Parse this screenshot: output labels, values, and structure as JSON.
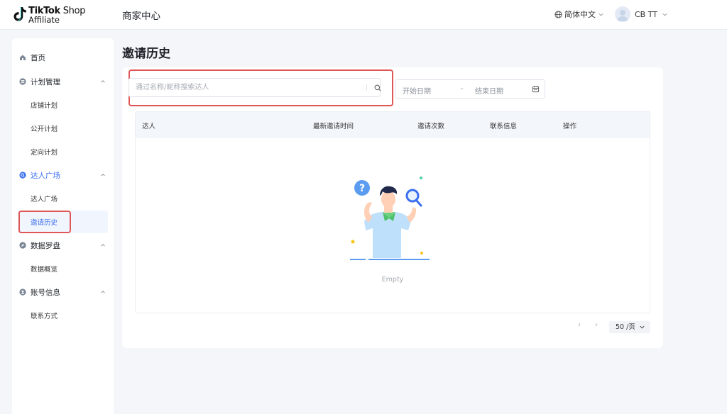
{
  "header": {
    "logo": {
      "line1_bold": "TikTok",
      "line1_light": " Shop",
      "line2": "Affiliate"
    },
    "title": "商家中心",
    "language": "简体中文",
    "user_name": "CB TT"
  },
  "sidebar": {
    "home": "首页",
    "groups": [
      {
        "label": "计划管理",
        "icon": "list-icon",
        "items": [
          "店铺计划",
          "公开计划",
          "定向计划"
        ]
      },
      {
        "label": "达人广场",
        "icon": "search-circle-icon",
        "items": [
          "达人广场",
          "邀请历史"
        ]
      },
      {
        "label": "数据罗盘",
        "icon": "compass-icon",
        "items": [
          "数据概览"
        ]
      },
      {
        "label": "账号信息",
        "icon": "account-icon",
        "items": [
          "联系方式"
        ]
      }
    ],
    "active_item": "邀请历史"
  },
  "main": {
    "page_title": "邀请历史",
    "search": {
      "placeholder": "通过名称/昵称搜索达人",
      "value": ""
    },
    "date_range": {
      "start_placeholder": "开始日期",
      "separator": "-",
      "end_placeholder": "结束日期"
    },
    "table": {
      "columns": [
        "达人",
        "最新邀请时间",
        "邀请次数",
        "联系信息",
        "操作"
      ],
      "rows": [],
      "empty_text": "Empty"
    },
    "pagination": {
      "prev": "‹",
      "next": "›",
      "page_size": "50 /页"
    }
  },
  "colors": {
    "accent": "#3a6ff0",
    "highlight": "#e05757",
    "header_bg": "#f3f6fb",
    "page_bg": "#f4f6fa"
  }
}
